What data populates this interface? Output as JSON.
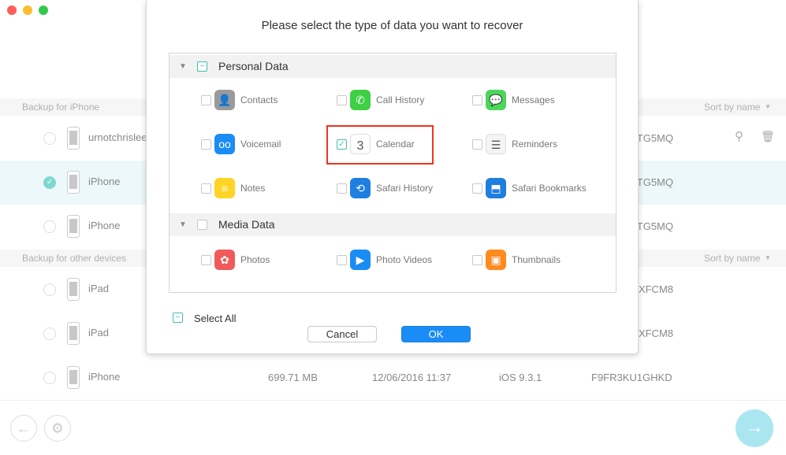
{
  "window": {
    "controls": [
      "close",
      "minimize",
      "maximize"
    ]
  },
  "sections": [
    {
      "title": "Backup for iPhone",
      "sort_label": "Sort by name",
      "rows": [
        {
          "name": "urnotchrislee",
          "serial": "TG5MQ",
          "selected": false,
          "actions": [
            "search-icon",
            "trash-icon"
          ]
        },
        {
          "name": "iPhone",
          "serial": "TG5MQ",
          "selected": true
        },
        {
          "name": "iPhone",
          "serial": "TG5MQ",
          "selected": false
        }
      ]
    },
    {
      "title": "Backup for other devices",
      "sort_label": "Sort by name",
      "rows": [
        {
          "name": "iPad",
          "serial": "XFCM8",
          "selected": false
        },
        {
          "name": "iPad",
          "serial": "XFCM8",
          "selected": false
        },
        {
          "name": "iPhone",
          "size": "699.71 MB",
          "date": "12/06/2016 11:37",
          "ios": "iOS 9.3.1",
          "serial": "F9FR3KU1GHKD",
          "selected": false
        }
      ]
    }
  ],
  "dialog": {
    "title": "Please select the type of data you want to recover",
    "groups": [
      {
        "label": "Personal Data",
        "state": "partial",
        "items": [
          {
            "label": "Contacts",
            "icon": "contacts-icon",
            "checked": false,
            "color": "#9a9a9a"
          },
          {
            "label": "Call History",
            "icon": "phone-icon",
            "checked": false,
            "color": "#3fcf45"
          },
          {
            "label": "Messages",
            "icon": "messages-icon",
            "checked": false,
            "color": "#4cd65a"
          },
          {
            "label": "Voicemail",
            "icon": "voicemail-icon",
            "checked": false,
            "color": "#1a8cf5"
          },
          {
            "label": "Calendar",
            "icon": "calendar-icon",
            "checked": true,
            "color": "#ffffff"
          },
          {
            "label": "Reminders",
            "icon": "reminders-icon",
            "checked": false,
            "color": "#f4f4f4"
          },
          {
            "label": "Notes",
            "icon": "notes-icon",
            "checked": false,
            "color": "#ffd426"
          },
          {
            "label": "Safari History",
            "icon": "safari-history-icon",
            "checked": false,
            "color": "#1f7fe0"
          },
          {
            "label": "Safari Bookmarks",
            "icon": "safari-bookmarks-icon",
            "checked": false,
            "color": "#1f7fe0"
          }
        ]
      },
      {
        "label": "Media Data",
        "state": "unchecked",
        "items": [
          {
            "label": "Photos",
            "icon": "photos-icon",
            "checked": false,
            "color": "#f05a5a"
          },
          {
            "label": "Photo Videos",
            "icon": "photo-videos-icon",
            "checked": false,
            "color": "#1a8cf5"
          },
          {
            "label": "Thumbnails",
            "icon": "thumbnails-icon",
            "checked": false,
            "color": "#ff8a1f"
          }
        ]
      }
    ],
    "select_all": "Select All",
    "cancel": "Cancel",
    "ok": "OK",
    "highlight_color": "#f0341c"
  },
  "colors": {
    "accent": "#3cbfb0",
    "ok_button": "#1a8cf5",
    "selected_row": "#ecf8f9"
  }
}
